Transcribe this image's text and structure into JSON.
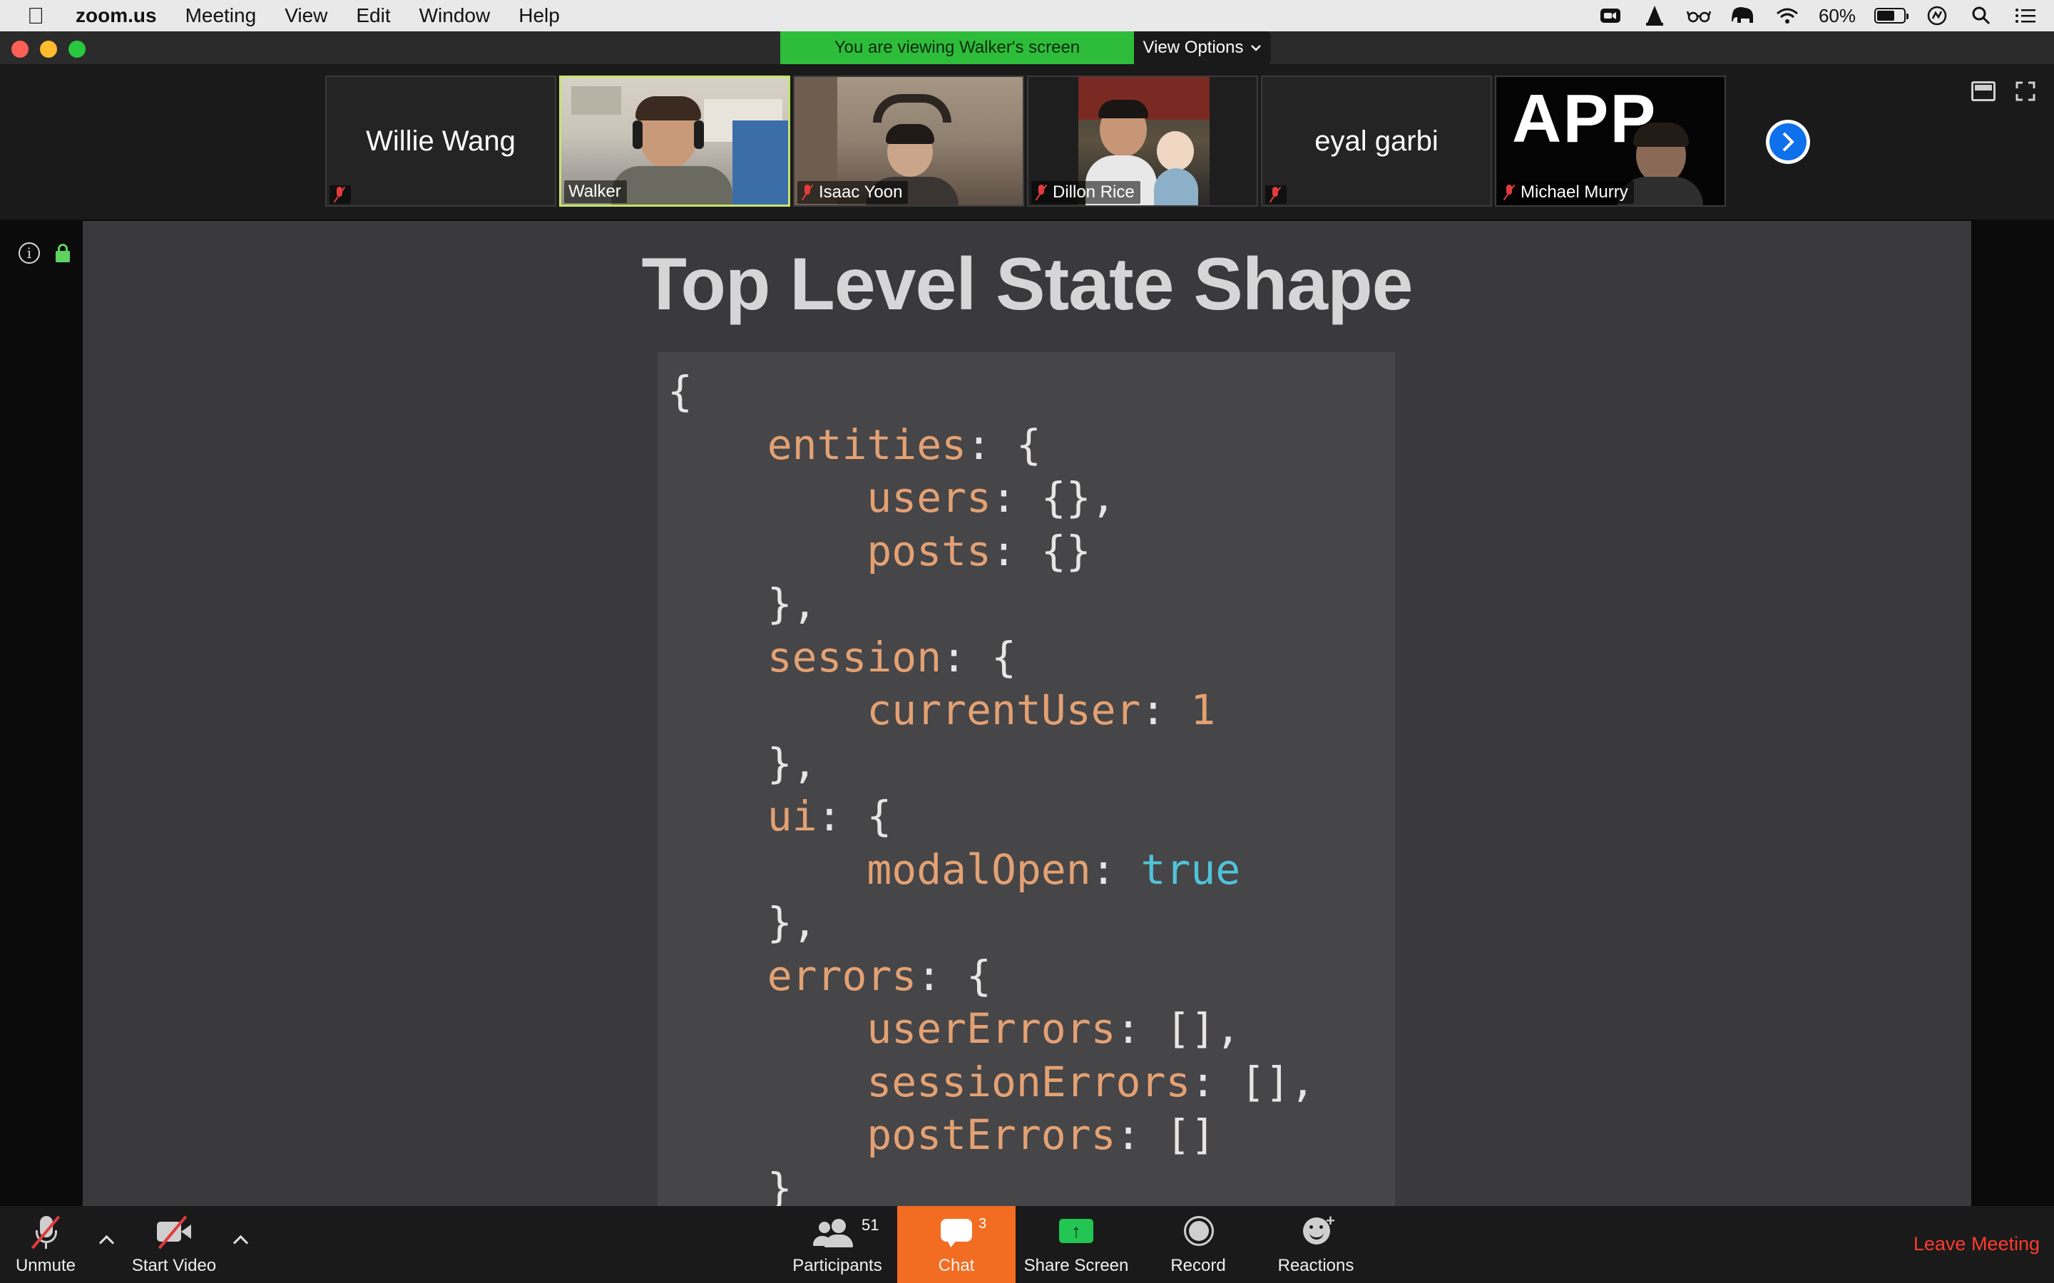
{
  "menubar": {
    "apple": "",
    "app_name": "zoom.us",
    "menus": [
      "Meeting",
      "View",
      "Edit",
      "Window",
      "Help"
    ],
    "battery_percent": "60%"
  },
  "window": {
    "banner_text": "You are viewing Walker's screen",
    "view_options_label": "View Options"
  },
  "participants_strip": [
    {
      "name": "Willie Wang",
      "video": false,
      "muted": true,
      "big_name": "Willie Wang"
    },
    {
      "name": "Walker",
      "video": true,
      "muted": false,
      "active_speaker": true
    },
    {
      "name": "Isaac Yoon",
      "video": true,
      "muted": true
    },
    {
      "name": "Dillon Rice",
      "video": true,
      "muted": true
    },
    {
      "name": "eyal garbi",
      "video": false,
      "muted": true,
      "big_name": "eyal garbi"
    },
    {
      "name": "Michael Murry",
      "video": true,
      "muted": true,
      "logo_text": "APP"
    }
  ],
  "slide": {
    "title": "Top Level State Shape",
    "code_lines": [
      {
        "indent": 0,
        "parts": [
          {
            "t": "{",
            "c": "p"
          }
        ]
      },
      {
        "indent": 1,
        "parts": [
          {
            "t": "entities",
            "c": "k"
          },
          {
            "t": ": {",
            "c": "p"
          }
        ]
      },
      {
        "indent": 2,
        "parts": [
          {
            "t": "users",
            "c": "k"
          },
          {
            "t": ": {},",
            "c": "p"
          }
        ]
      },
      {
        "indent": 2,
        "parts": [
          {
            "t": "posts",
            "c": "k"
          },
          {
            "t": ": {}",
            "c": "p"
          }
        ]
      },
      {
        "indent": 1,
        "parts": [
          {
            "t": "},",
            "c": "p"
          }
        ]
      },
      {
        "indent": 1,
        "parts": [
          {
            "t": "session",
            "c": "k"
          },
          {
            "t": ": {",
            "c": "p"
          }
        ]
      },
      {
        "indent": 2,
        "parts": [
          {
            "t": "currentUser",
            "c": "k"
          },
          {
            "t": ": ",
            "c": "p"
          },
          {
            "t": "1",
            "c": "n"
          }
        ]
      },
      {
        "indent": 1,
        "parts": [
          {
            "t": "},",
            "c": "p"
          }
        ]
      },
      {
        "indent": 1,
        "parts": [
          {
            "t": "ui",
            "c": "k"
          },
          {
            "t": ": {",
            "c": "p"
          }
        ]
      },
      {
        "indent": 2,
        "parts": [
          {
            "t": "modalOpen",
            "c": "k"
          },
          {
            "t": ": ",
            "c": "p"
          },
          {
            "t": "true",
            "c": "b"
          }
        ]
      },
      {
        "indent": 1,
        "parts": [
          {
            "t": "},",
            "c": "p"
          }
        ]
      },
      {
        "indent": 1,
        "parts": [
          {
            "t": "errors",
            "c": "k"
          },
          {
            "t": ": {",
            "c": "p"
          }
        ]
      },
      {
        "indent": 2,
        "parts": [
          {
            "t": "userErrors",
            "c": "k"
          },
          {
            "t": ": [],",
            "c": "p"
          }
        ]
      },
      {
        "indent": 2,
        "parts": [
          {
            "t": "sessionErrors",
            "c": "k"
          },
          {
            "t": ": [],",
            "c": "p"
          }
        ]
      },
      {
        "indent": 2,
        "parts": [
          {
            "t": "postErrors",
            "c": "k"
          },
          {
            "t": ": []",
            "c": "p"
          }
        ]
      },
      {
        "indent": 1,
        "parts": [
          {
            "t": "}",
            "c": "p"
          }
        ]
      }
    ]
  },
  "toolbar": {
    "unmute_label": "Unmute",
    "start_video_label": "Start Video",
    "participants_label": "Participants",
    "participants_count": "51",
    "chat_label": "Chat",
    "chat_count": "3",
    "share_label": "Share Screen",
    "record_label": "Record",
    "reactions_label": "Reactions",
    "leave_label": "Leave Meeting"
  },
  "colors": {
    "banner_green": "#2ebd3a",
    "chat_orange": "#f26d21",
    "leave_red": "#ff3b30",
    "code_key": "#e3a173",
    "code_bool": "#50c3d8",
    "next_blue": "#0e71eb"
  }
}
